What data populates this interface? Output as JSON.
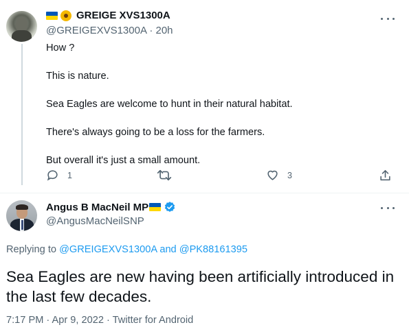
{
  "tweet1": {
    "display_name": "GREIGE XVS1300A",
    "handle": "@GREIGEXVS1300A",
    "separator": "·",
    "time": "20h",
    "lines": [
      "How ?",
      "This is nature.",
      "Sea Eagles are welcome to hunt in their natural habitat.",
      "There's always going to be a loss for the farmers.",
      "But overall it's just a small amount."
    ],
    "reply_count": "1",
    "retweet_count": "",
    "like_count": "3",
    "icons": [
      "ukraine-flag-icon",
      "sunflower-icon",
      "more-icon",
      "reply-icon",
      "retweet-icon",
      "like-icon",
      "share-icon"
    ]
  },
  "tweet2": {
    "display_name": "Angus B MacNeil MP",
    "handle": "@AngusMacNeilSNP",
    "replying_prefix": "Replying to",
    "reply_to_1": "@GREIGEXVS1300A",
    "reply_and": "and",
    "reply_to_2": "@PK88161395",
    "text": "Sea Eagles are new having been artificially introduced in the last few decades.",
    "timestamp": "7:17 PM · Apr 9, 2022 · Twitter for Android",
    "icons": [
      "ukraine-flag-icon",
      "verified-badge-icon",
      "more-icon"
    ]
  },
  "colors": {
    "text_primary": "#0f1419",
    "text_secondary": "#536471",
    "link": "#1d9bf0",
    "divider": "#eff3f4",
    "thread_line": "#cfd9de",
    "flag_blue": "#0057b7",
    "flag_yellow": "#ffd700"
  }
}
